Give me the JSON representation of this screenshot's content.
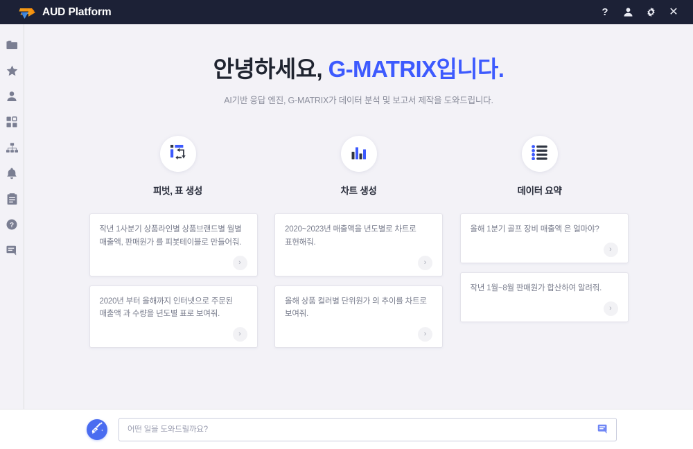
{
  "window": {
    "title": "AUD Platform",
    "logo_icon": "arrow-logo-icon",
    "controls": [
      {
        "name": "help-button",
        "icon": "question-mark-icon",
        "glyph": "?"
      },
      {
        "name": "account-button",
        "icon": "user-icon",
        "glyph": ""
      },
      {
        "name": "settings-button",
        "icon": "gear-icon",
        "glyph": ""
      },
      {
        "name": "close-button",
        "icon": "close-icon",
        "glyph": "✕"
      }
    ]
  },
  "sidebar": {
    "items": [
      {
        "name": "sidebar-item-folder",
        "icon": "folder-icon"
      },
      {
        "name": "sidebar-item-favorites",
        "icon": "star-icon"
      },
      {
        "name": "sidebar-item-user",
        "icon": "person-icon"
      },
      {
        "name": "sidebar-item-dashboard",
        "icon": "grid-icon"
      },
      {
        "name": "sidebar-item-organization",
        "icon": "sitemap-icon"
      },
      {
        "name": "sidebar-item-notifications",
        "icon": "bell-icon"
      },
      {
        "name": "sidebar-item-reports",
        "icon": "clipboard-icon"
      },
      {
        "name": "sidebar-item-help",
        "icon": "question-circle-icon"
      },
      {
        "name": "sidebar-item-chat",
        "icon": "chat-icon"
      }
    ]
  },
  "hero": {
    "greeting": "안녕하세요, ",
    "brand": "G-MATRIX입니다.",
    "subtitle": "AI기반 응답 엔진, G-MATRIX가 데이터 분석 및 보고서 제작을 도와드립니다."
  },
  "features": [
    {
      "label": "피벗, 표 생성",
      "icon": "pivot-table-icon"
    },
    {
      "label": "차트 생성",
      "icon": "bar-chart-icon"
    },
    {
      "label": "데이터 요약",
      "icon": "list-summary-icon"
    }
  ],
  "suggestions": {
    "columns": [
      {
        "cards": [
          {
            "text": "작년 1사분기 상품라인별 상품브랜드별 월별 매출액, 판매원가 를 피봇테이블로 만들어줘."
          },
          {
            "text": "2020년 부터 올해까지 인터넷으로 주문된 매출액 과 수량을 년도별 표로 보여줘."
          }
        ]
      },
      {
        "cards": [
          {
            "text": "2020~2023년 매출액을 년도별로 차트로 표현해줘."
          },
          {
            "text": "올해 상품 컬러별 단위원가 의 추이를 차트로 보여줘."
          }
        ]
      },
      {
        "cards": [
          {
            "text": "올해 1분기 골프 장비 매출액 은 얼마야?"
          },
          {
            "text": "작년 1월~8월 판매원가 합산하여 알려줘."
          }
        ]
      }
    ],
    "go_glyph": "›"
  },
  "composer": {
    "magic_icon": "magic-broom-icon",
    "placeholder": "어떤 일을 도와드릴까요?",
    "value": "",
    "send_icon": "send-message-icon"
  },
  "colors": {
    "titlebar": "#1c2136",
    "stage": "#f3f2f7",
    "accent": "#3d5afe",
    "accent_button": "#4a6cf0",
    "card_border": "#e4e3ea",
    "muted_text": "#787c8c"
  }
}
